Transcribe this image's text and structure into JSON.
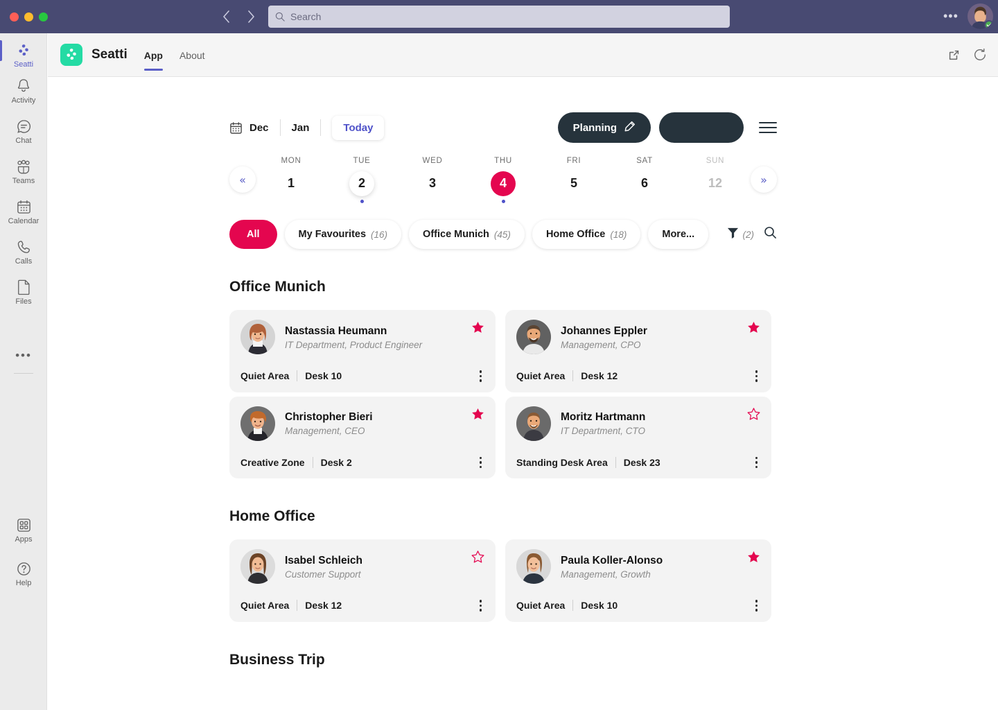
{
  "titlebar": {
    "search": {
      "placeholder": "Search",
      "icon": "search-icon"
    },
    "back_icon": "chevron-left-icon",
    "forward_icon": "chevron-right-icon",
    "more_label": "•••",
    "presence": "available",
    "avatar_alt": "user-avatar"
  },
  "rail": {
    "pinned_app": {
      "label": "Seatti",
      "icon": "seatti-logo-icon"
    },
    "items": [
      {
        "label": "Activity",
        "icon": "bell-icon"
      },
      {
        "label": "Chat",
        "icon": "chat-icon"
      },
      {
        "label": "Teams",
        "icon": "teams-icon"
      },
      {
        "label": "Calendar",
        "icon": "calendar-icon"
      },
      {
        "label": "Calls",
        "icon": "phone-icon"
      },
      {
        "label": "Files",
        "icon": "file-icon"
      }
    ],
    "more_label": "•••",
    "bottom_items": [
      {
        "label": "Apps",
        "icon": "apps-icon"
      },
      {
        "label": "Help",
        "icon": "help-icon"
      }
    ]
  },
  "app_header": {
    "title": "Seatti",
    "logo_icon": "seatti-logo-icon",
    "tabs": [
      {
        "label": "App",
        "active": true
      },
      {
        "label": "About",
        "active": false
      }
    ],
    "popout_icon": "open-in-new-window-icon",
    "refresh_icon": "refresh-icon"
  },
  "toolbar": {
    "calendar_icon": "calendar-icon",
    "month_prev": "Dec",
    "month_next": "Jan",
    "today_label": "Today",
    "planning_label": "Planning",
    "planning_icon": "pencil-icon",
    "secondary_button_label": "",
    "menu_icon": "hamburger-menu-icon"
  },
  "week": {
    "prev_icon": "«",
    "next_icon": "»",
    "days": [
      {
        "dow": "MON",
        "num": "1",
        "state": "normal",
        "dot": false
      },
      {
        "dow": "TUE",
        "num": "2",
        "state": "selected",
        "dot": true
      },
      {
        "dow": "WED",
        "num": "3",
        "state": "normal",
        "dot": false
      },
      {
        "dow": "THU",
        "num": "4",
        "state": "today",
        "dot": true
      },
      {
        "dow": "FRI",
        "num": "5",
        "state": "normal",
        "dot": false
      },
      {
        "dow": "SAT",
        "num": "6",
        "state": "normal",
        "dot": false
      },
      {
        "dow": "SUN",
        "num": "12",
        "state": "weekend",
        "dot": false
      }
    ]
  },
  "filters": {
    "chips": [
      {
        "label": "All",
        "count": "",
        "active": true
      },
      {
        "label": "My Favourites",
        "count": "(16)",
        "active": false
      },
      {
        "label": "Office Munich",
        "count": "(45)",
        "active": false
      },
      {
        "label": "Home Office",
        "count": "(18)",
        "active": false
      },
      {
        "label": "More...",
        "count": "",
        "active": false
      }
    ],
    "filter_icon": "filter-icon",
    "filter_count": "(2)",
    "search_icon": "search-icon"
  },
  "sections": [
    {
      "title": "Office Munich",
      "columns": [
        [
          {
            "name": "Nastassia Heumann",
            "role": "IT Department, Product Engineer",
            "area": "Quiet Area",
            "desk": "Desk 10",
            "favourite": true,
            "avatar": "woman-red-hair"
          },
          {
            "name": "Christopher Bieri",
            "role": "Management, CEO",
            "area": "Creative Zone",
            "desk": "Desk 2",
            "favourite": true,
            "avatar": "man-curly-hair"
          }
        ],
        [
          {
            "name": "Johannes Eppler",
            "role": "Management, CPO",
            "area": "Quiet Area",
            "desk": "Desk 12",
            "favourite": true,
            "avatar": "man-bald-beard"
          },
          {
            "name": "Moritz Hartmann",
            "role": "IT Department, CTO",
            "area": "Standing Desk Area",
            "desk": "Desk 23",
            "favourite": false,
            "avatar": "man-short-hair"
          }
        ]
      ]
    },
    {
      "title": "Home Office",
      "columns": [
        [
          {
            "name": "Isabel Schleich",
            "role": "Customer Support",
            "area": "Quiet Area",
            "desk": "Desk 12",
            "favourite": false,
            "avatar": "woman-brown-hair"
          }
        ],
        [
          {
            "name": "Paula Koller-Alonso",
            "role": "Management, Growth",
            "area": "Quiet Area",
            "desk": "Desk 10",
            "favourite": true,
            "avatar": "woman-bob-hair"
          }
        ]
      ]
    },
    {
      "title": "Business Trip",
      "columns": []
    }
  ],
  "colors": {
    "accent_pink": "#e4064f",
    "teams_purple": "#484a72",
    "indigo": "#5b5fc7",
    "dark_pill": "#26333c",
    "seatti_green": "#24dba4",
    "card_bg": "#f3f3f3"
  }
}
